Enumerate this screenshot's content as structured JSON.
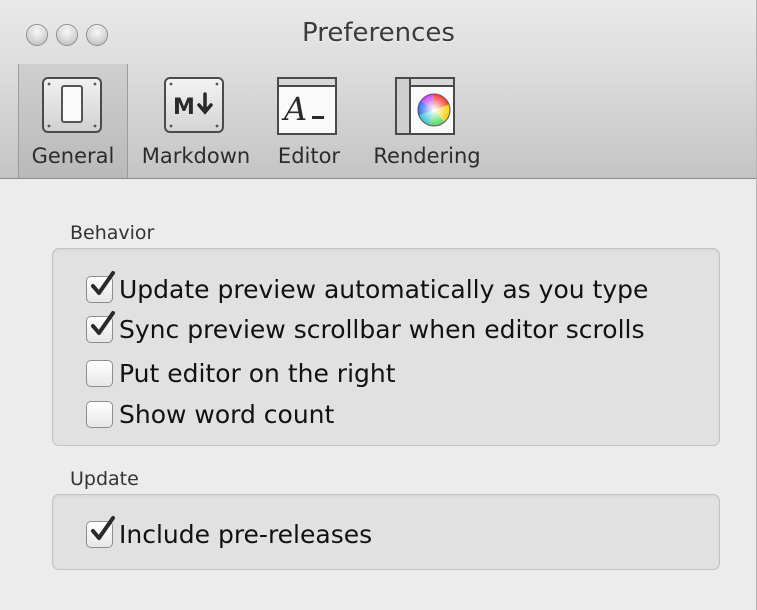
{
  "window": {
    "title": "Preferences"
  },
  "toolbar": {
    "tabs": [
      {
        "label": "General",
        "icon": "general-switch-icon",
        "selected": true
      },
      {
        "label": "Markdown",
        "icon": "markdown-icon",
        "selected": false
      },
      {
        "label": "Editor",
        "icon": "editor-text-icon",
        "selected": false
      },
      {
        "label": "Rendering",
        "icon": "color-wheel-icon",
        "selected": false
      }
    ]
  },
  "behavior": {
    "title": "Behavior",
    "options": [
      {
        "label": "Update preview automatically as you type",
        "checked": true
      },
      {
        "label": "Sync preview scrollbar when editor scrolls",
        "checked": true
      },
      {
        "label": "Put editor on the right",
        "checked": false
      },
      {
        "label": "Show word count",
        "checked": false
      }
    ]
  },
  "update": {
    "title": "Update",
    "options": [
      {
        "label": "Include pre-releases",
        "checked": true
      }
    ]
  },
  "colors": {
    "window_bg": "#ececec",
    "group_bg": "#e1e1e1",
    "check_mark": "#2a2a2a"
  }
}
